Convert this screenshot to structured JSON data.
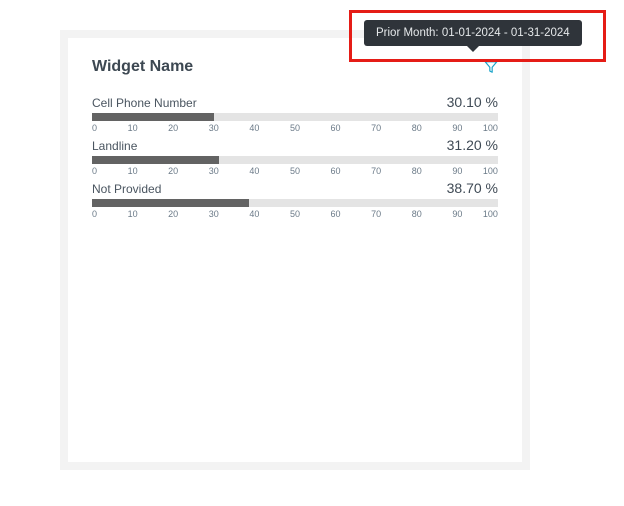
{
  "card": {
    "title": "Widget Name"
  },
  "tooltip": {
    "text": "Prior Month: 01-01-2024 - 01-31-2024"
  },
  "rows": [
    {
      "label": "Cell Phone Number",
      "value_text": "30.10 %",
      "value": 30.1
    },
    {
      "label": "Landline",
      "value_text": "31.20 %",
      "value": 31.2
    },
    {
      "label": "Not Provided",
      "value_text": "38.70 %",
      "value": 38.7
    }
  ],
  "ticks": [
    "0",
    "10",
    "20",
    "30",
    "40",
    "50",
    "60",
    "70",
    "80",
    "90",
    "100"
  ],
  "chart_data": {
    "type": "bar",
    "title": "Widget Name",
    "categories": [
      "Cell Phone Number",
      "Landline",
      "Not Provided"
    ],
    "values": [
      30.1,
      31.2,
      38.7
    ],
    "xlabel": "",
    "ylabel": "",
    "ylim": [
      0,
      100
    ],
    "orientation": "horizontal",
    "tick_values": [
      0,
      10,
      20,
      30,
      40,
      50,
      60,
      70,
      80,
      90,
      100
    ]
  }
}
